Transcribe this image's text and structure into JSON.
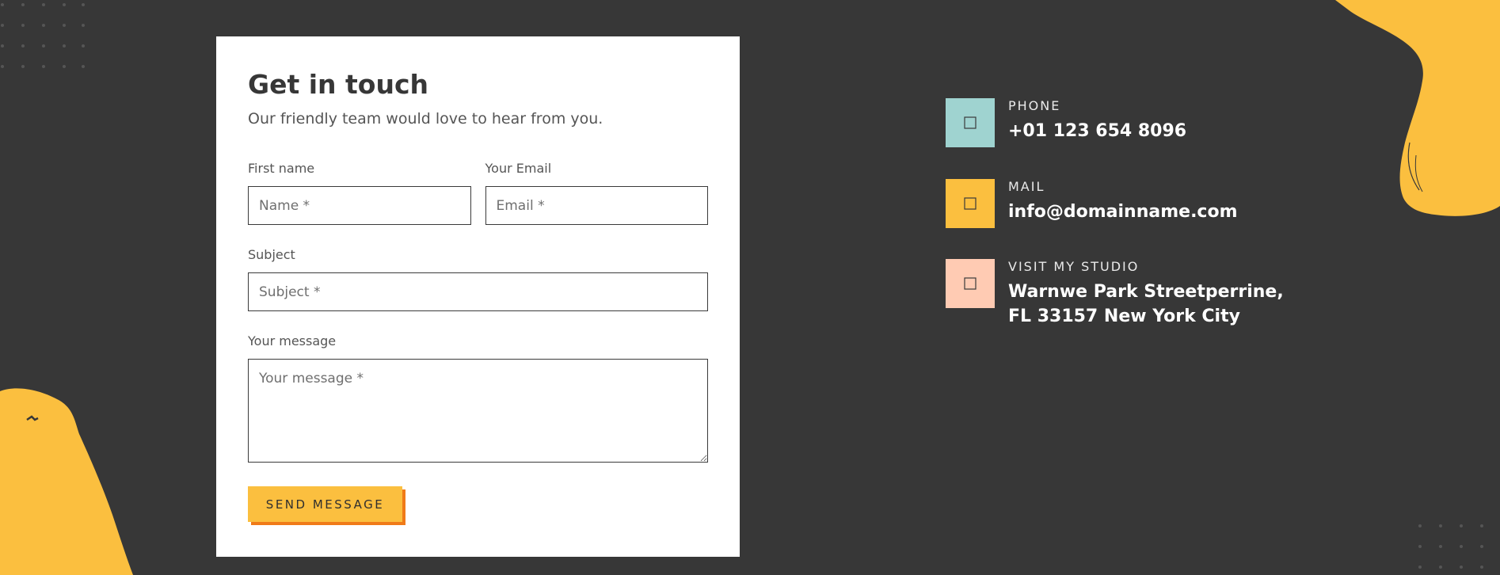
{
  "form": {
    "title": "Get in touch",
    "subtitle": "Our friendly team would love to hear from you.",
    "first_name": {
      "label": "First name",
      "placeholder": "Name *"
    },
    "email": {
      "label": "Your Email",
      "placeholder": "Email *"
    },
    "subject": {
      "label": "Subject",
      "placeholder": "Subject *"
    },
    "message": {
      "label": "Your message",
      "placeholder": "Your message *"
    },
    "send_label": "SEND MESSAGE"
  },
  "contact": [
    {
      "label": "PHONE",
      "value_line1": "+01 123 654 8096",
      "icon": "phone-icon",
      "color": "#9fd3d0"
    },
    {
      "label": "MAIL",
      "value_line1": "info@domainname.com",
      "icon": "mail-icon",
      "color": "#fbbf3f"
    },
    {
      "label": "VISIT MY STUDIO",
      "value_line1": "Warnwe Park Streetperrine,",
      "value_line2": "FL 33157 New York City",
      "icon": "location-icon",
      "color": "#ffcbb3"
    }
  ],
  "colors": {
    "background": "#373737",
    "accent": "#fbbf3f",
    "button_shadow": "#f07b18"
  }
}
